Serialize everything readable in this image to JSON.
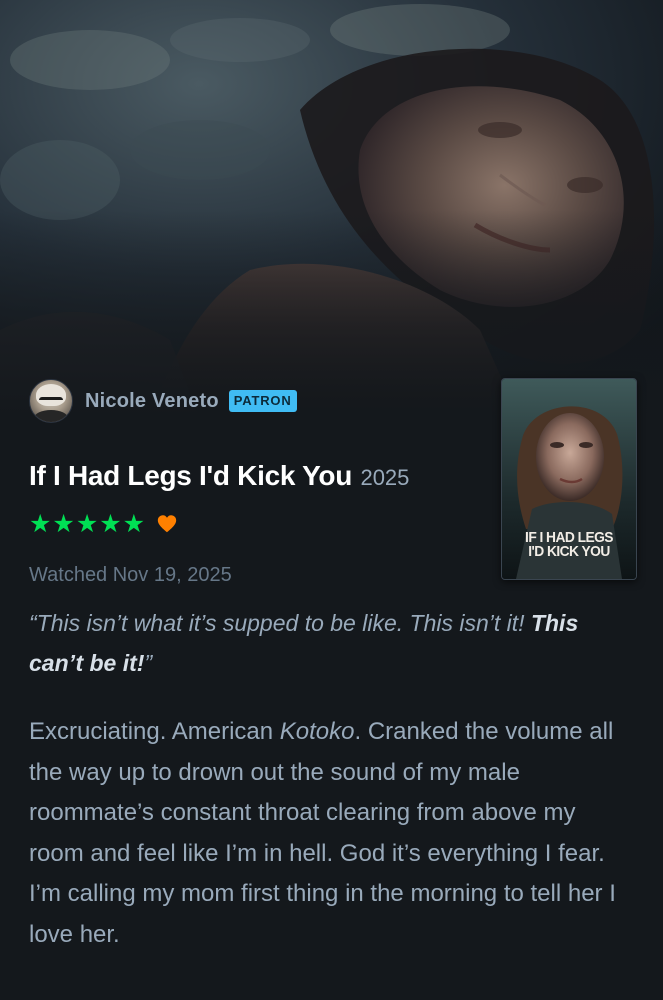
{
  "reviewer": {
    "name": "Nicole Veneto",
    "badge": "PATRON"
  },
  "film": {
    "title": "If I Had Legs I'd Kick You",
    "year": "2025",
    "poster_title_line1": "IF I HAD LEGS",
    "poster_title_line2": "I'D KICK YOU"
  },
  "rating": {
    "stars": "★★★★★",
    "liked": true,
    "colors": {
      "stars": "#00e054",
      "heart": "#ff8000"
    }
  },
  "watched": "Watched Nov 19, 2025",
  "quote": {
    "open": "“This isn’t what it’s supped to be like. This isn’t it! ",
    "bold": "This can’t be it!",
    "close": "”"
  },
  "review": {
    "part1": "Excruciating. American ",
    "italic": "Kotoko",
    "part2": ". Cranked the volume all the way up to drown out the sound of my male roommate’s constant throat clearing from above my room and feel like I’m in hell. God it’s everything I fear. I’m calling my mom first thing in the morning to tell her I love her."
  },
  "theme": {
    "background": "#14181c",
    "badge": "#40bcf4",
    "text": "#99aabb",
    "title": "#ffffff"
  }
}
